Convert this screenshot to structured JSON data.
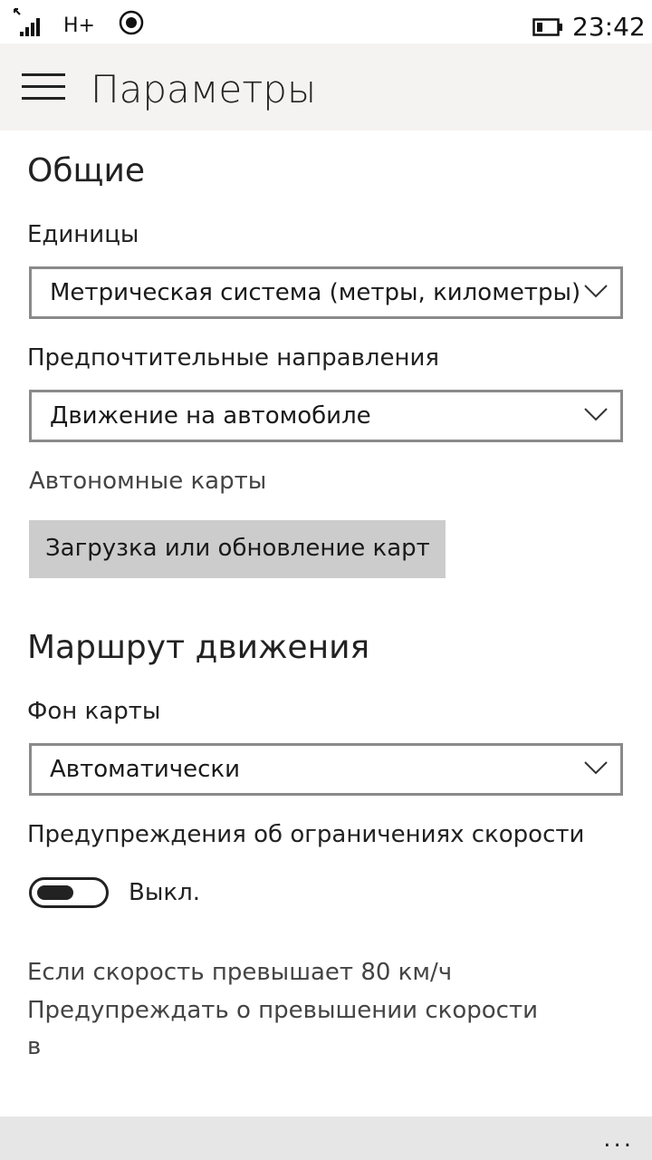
{
  "status_bar": {
    "network": "H+",
    "time": "23:42",
    "signal_bars": 4,
    "battery_level": 0.25
  },
  "header": {
    "menu_icon": "hamburger-icon",
    "title": "Параметры"
  },
  "general": {
    "heading": "Общие",
    "units_label": "Единицы",
    "units_value": "Метрическая система (метры, километры)",
    "directions_label": "Предпочтительные направления",
    "directions_value": "Движение на автомобиле",
    "offline_maps_label": "Автономные карты",
    "offline_maps_button": "Загрузка или обновление карт"
  },
  "route": {
    "heading": "Маршрут движения",
    "map_bg_label": "Фон карты",
    "map_bg_value": "Автоматически",
    "speed_warnings_label": "Предупреждения об ограничениях скорости",
    "speed_toggle_state": "Выкл.",
    "speed_toggle_on": false,
    "info_line1": "Если скорость превышает 80 км/ч",
    "info_line2": "Предупреждать о превышении скорости",
    "info_line3": "в"
  },
  "app_bar": {
    "more_label": "..."
  },
  "colors": {
    "header_bg": "#f4f3f1",
    "button_bg": "#cccccc",
    "app_bar_bg": "#e6e6e6",
    "select_border": "#8a8a8a"
  }
}
